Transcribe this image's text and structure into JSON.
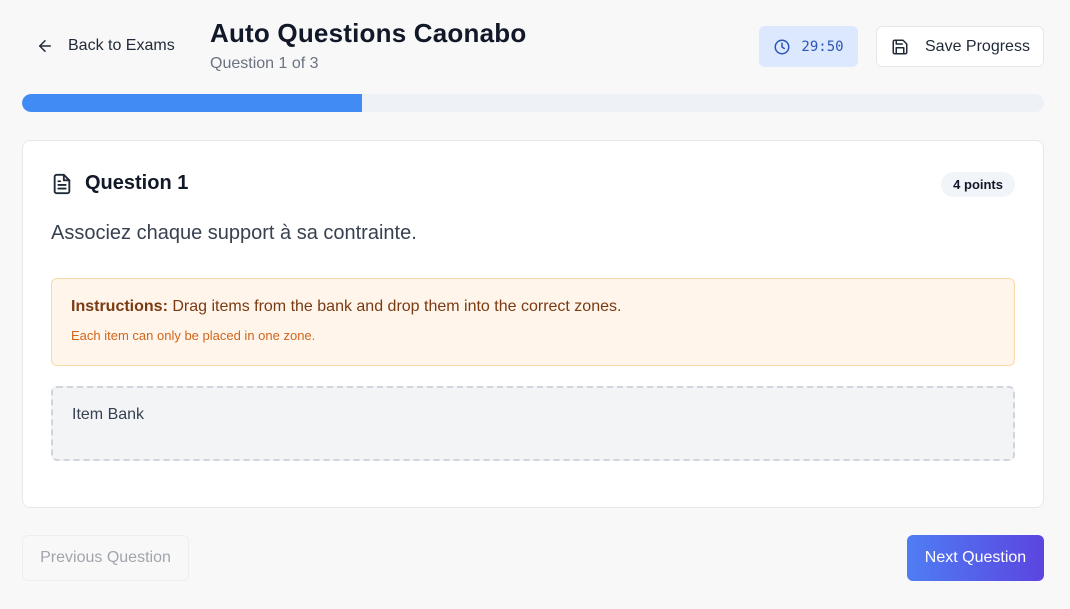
{
  "header": {
    "back_label": "Back to Exams",
    "exam_title": "Auto Questions Caonabo",
    "question_counter": "Question 1 of 3",
    "timer": "29:50",
    "save_label": "Save Progress"
  },
  "progress": {
    "fraction": 0.333
  },
  "question": {
    "title": "Question 1",
    "points": "4 points",
    "prompt": "Associez chaque support à sa contrainte.",
    "instructions_label": "Instructions:",
    "instructions_text": " Drag items from the bank and drop them into the correct zones.",
    "instructions_note": "Each item can only be placed in one zone.",
    "item_bank_label": "Item Bank"
  },
  "footer": {
    "prev_label": "Previous Question",
    "next_label": "Next Question"
  },
  "colors": {
    "accent": "#418cf4",
    "timer_bg": "#dbe8fd",
    "instructions_bg": "#fff5eb",
    "next_gradient_start": "#4f7df3",
    "next_gradient_end": "#5b45e0"
  }
}
